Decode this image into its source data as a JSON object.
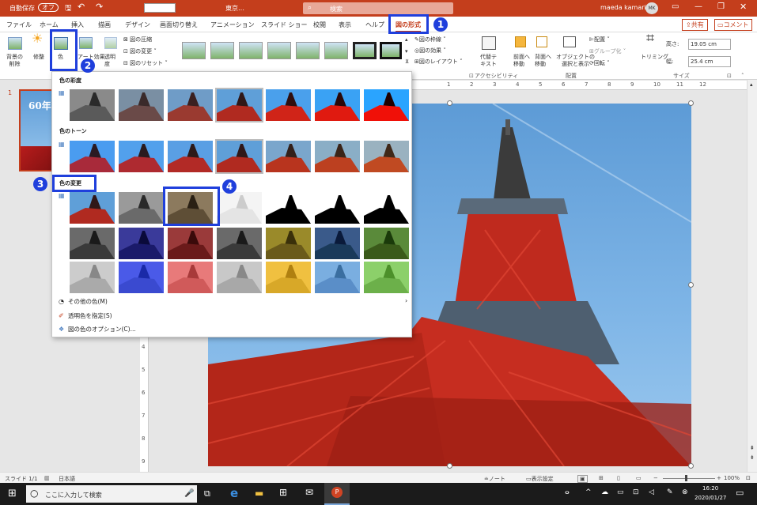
{
  "titlebar": {
    "autosave": "自動保存",
    "autosave_state": "オフ",
    "filename": "東京…",
    "search": "検索",
    "user": "maeda kamari",
    "initials": "MK"
  },
  "menu": {
    "tabs": [
      "ファイル",
      "ホーム",
      "挿入",
      "描画",
      "デザイン",
      "画面切り替え",
      "アニメーション",
      "スライド ショー",
      "校閲",
      "表示",
      "ヘルプ",
      "図の形式"
    ],
    "share": "共有",
    "comment": "コメント"
  },
  "ribbon": {
    "remove_bg": "背景の\n削除",
    "corrections": "修整",
    "color": "色",
    "art_effects": "アート効果",
    "transparency": "透明度",
    "compress": "図の圧縮",
    "change": "図の変更",
    "reset": "図のリセット",
    "border": "図の枠線",
    "effects": "図の効果",
    "layout": "図のレイアウト",
    "accessibility": "アクセシビリティ",
    "alt_text": "代替テ\nキスト",
    "bring_forward": "前面へ\n移動",
    "send_backward": "背面へ\n移動",
    "selection_pane": "オブジェクトの\n選択と表示",
    "align": "配置",
    "group": "グループ化",
    "rotate": "回転",
    "arrange_group": "配置",
    "crop": "トリミング",
    "height_label": "高さ:",
    "height": "19.05 cm",
    "width_label": "幅:",
    "width": "25.4 cm",
    "size_group": "サイズ"
  },
  "thumb": {
    "num": "1",
    "text": "60年"
  },
  "ruler": {
    "h": [
      "1",
      "2",
      "3",
      "4",
      "5",
      "6",
      "7",
      "8",
      "9",
      "10",
      "11",
      "12"
    ],
    "v": [
      "4",
      "5",
      "6",
      "7",
      "8",
      "9"
    ]
  },
  "dropdown": {
    "saturation": "色の彩度",
    "tone": "色のトーン",
    "recolor": "色の変更",
    "more_colors": "その他の色(M)",
    "set_transparent": "透明色を指定(S)",
    "options": "図の色のオプション(C)..."
  },
  "callouts": [
    "1",
    "2",
    "3",
    "4"
  ],
  "status": {
    "slide": "スライド 1/1",
    "lang": "日本語",
    "notes": "ノート",
    "display": "表示設定",
    "zoom": "100%"
  },
  "taskbar": {
    "search": "ここに入力して検索",
    "time": "16:20",
    "date": "2020/01/27"
  }
}
